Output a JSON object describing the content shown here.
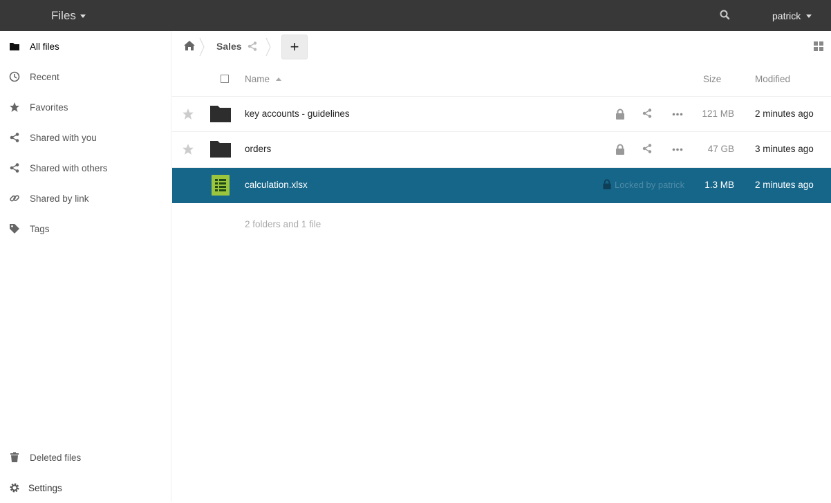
{
  "header": {
    "app_name": "Files",
    "user": "patrick"
  },
  "sidebar": {
    "items": [
      {
        "label": "All files",
        "icon": "folder-icon"
      },
      {
        "label": "Recent",
        "icon": "clock-icon"
      },
      {
        "label": "Favorites",
        "icon": "star-icon"
      },
      {
        "label": "Shared with you",
        "icon": "share-icon"
      },
      {
        "label": "Shared with others",
        "icon": "share-icon"
      },
      {
        "label": "Shared by link",
        "icon": "link-icon"
      },
      {
        "label": "Tags",
        "icon": "tag-icon"
      }
    ],
    "bottom": [
      {
        "label": "Deleted files",
        "icon": "trash-icon"
      },
      {
        "label": "Settings",
        "icon": "gear-icon"
      }
    ]
  },
  "breadcrumb": {
    "current": "Sales",
    "new_button": "+"
  },
  "table": {
    "columns": {
      "name": "Name",
      "size": "Size",
      "modified": "Modified"
    },
    "rows": [
      {
        "name": "key accounts - guidelines",
        "type": "folder",
        "size": "121 MB",
        "modified": "2 minutes ago"
      },
      {
        "name": "orders",
        "type": "folder",
        "size": "47 GB",
        "modified": "3 minutes ago"
      },
      {
        "name": "calculation.xlsx",
        "type": "spreadsheet",
        "size": "1.3 MB",
        "modified": "2 minutes ago",
        "locked_by": "Locked by patrick"
      }
    ],
    "summary": "2 folders and 1 file"
  },
  "colors": {
    "header_bg": "#383838",
    "selected_row": "#16668a",
    "spreadsheet_icon": "#9bc53d"
  }
}
